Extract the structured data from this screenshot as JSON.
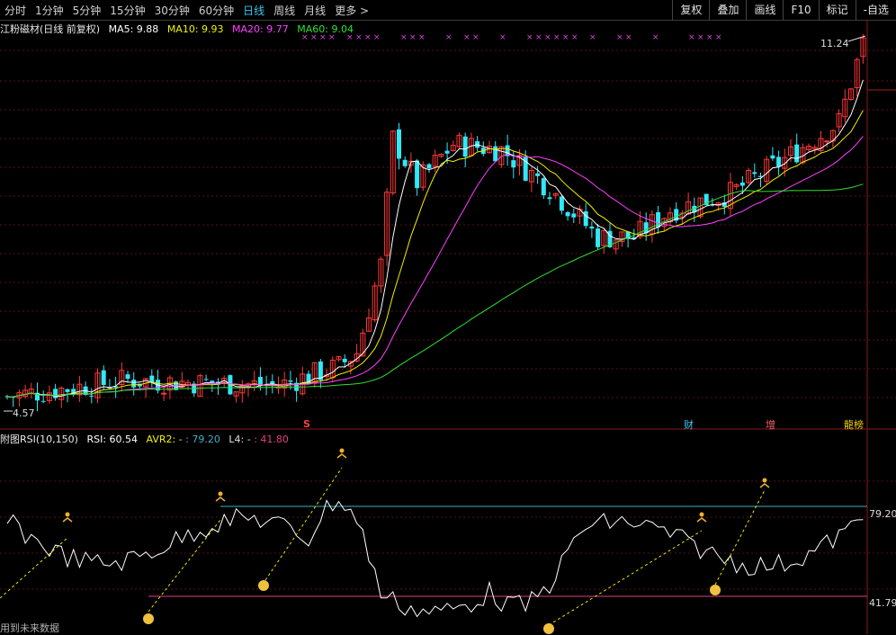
{
  "toolbar": {
    "periods": [
      "分时",
      "1分钟",
      "5分钟",
      "15分钟",
      "30分钟",
      "60分钟",
      "日线",
      "周线",
      "月线",
      "更多 >"
    ],
    "active_period": "日线",
    "tools": [
      "复权",
      "叠加",
      "画线",
      "F10",
      "标记",
      "-自选"
    ]
  },
  "main_legend": {
    "title": "江粉磁材(日线 前复权)",
    "ma5": "MA5: 9.88",
    "ma10": "MA10: 9.93",
    "ma20": "MA20: 9.77",
    "ma60": "MA60: 9.04",
    "ma5_color": "#ffffff",
    "ma10_color": "#f0f000",
    "ma20_color": "#ff40ff",
    "ma60_color": "#30e030"
  },
  "price_high_label": "11.24",
  "price_low_label": "4.57",
  "event_markers": {
    "s": "S",
    "cai": "财",
    "zeng": "增",
    "long": "龍榜"
  },
  "sub_legend": {
    "title": "附图RSI(10,150)",
    "rsi": "RSI: 60.54",
    "avr2_label": "AVR2: -",
    "avr2_value": ": 79.20",
    "l4_label": "L4: -",
    "l4_value": ": 41.80"
  },
  "sub_axis": {
    "upper": "79.20",
    "lower": "41.79"
  },
  "footer_note": "用到未来数据",
  "chart_data": {
    "type": "candlestick",
    "title": "江粉磁材(日线 前复权)",
    "price_range": [
      4.57,
      11.24
    ],
    "ma_last": {
      "MA5": 9.88,
      "MA10": 9.93,
      "MA20": 9.77,
      "MA60": 9.04
    },
    "rsi_last": 60.54,
    "avr2": 79.2,
    "l4": 41.8
  }
}
